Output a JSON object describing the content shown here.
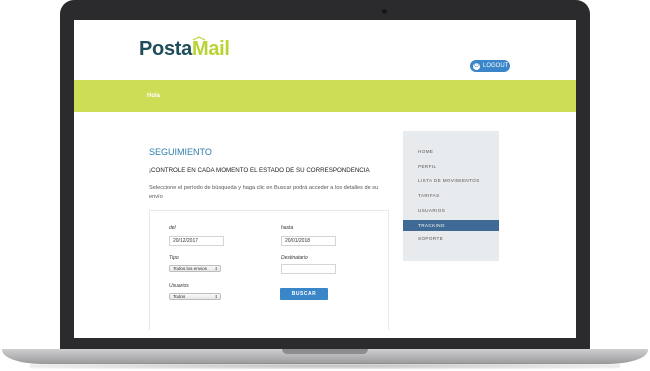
{
  "brand": {
    "logo_part1": "Posta",
    "logo_part2_letter": "M",
    "logo_part2_rest": "ail",
    "green": "#cddd55",
    "blue": "#3a86c8"
  },
  "header": {
    "logout_label": "LOGOUT",
    "greeting": "Hola"
  },
  "main": {
    "title": "SEGUIMIENTO",
    "subtitle": "¡CONTROLE EN CADA MOMENTO EL ESTADO DE SU CORRESPONDENCIA",
    "description": "Seleccione el período de búsqueda y haga clic en Buscar podrá acceder a los detalles de su envío"
  },
  "form": {
    "del_label": "del",
    "del_value": "20/12/2017",
    "hasta_label": "hasta",
    "hasta_value": "20/01/2018",
    "tipo_label": "Tipo",
    "tipo_value": "Todos los envios",
    "destinatario_label": "Destinatario",
    "destinatario_value": "",
    "usuarios_label": "Usuarios",
    "usuarios_value": "Todos",
    "search_button": "BUSCAR"
  },
  "sidebar": {
    "items": [
      {
        "label": "HOME",
        "active": false
      },
      {
        "label": "PERFIL",
        "active": false
      },
      {
        "label": "LISTA DE MOVIMIENTOS",
        "active": false
      },
      {
        "label": "TARIFAS",
        "active": false
      },
      {
        "label": "USUARIOS",
        "active": false
      },
      {
        "label": "TRACKING",
        "active": true
      },
      {
        "label": "SOPORTE",
        "active": false
      }
    ]
  }
}
